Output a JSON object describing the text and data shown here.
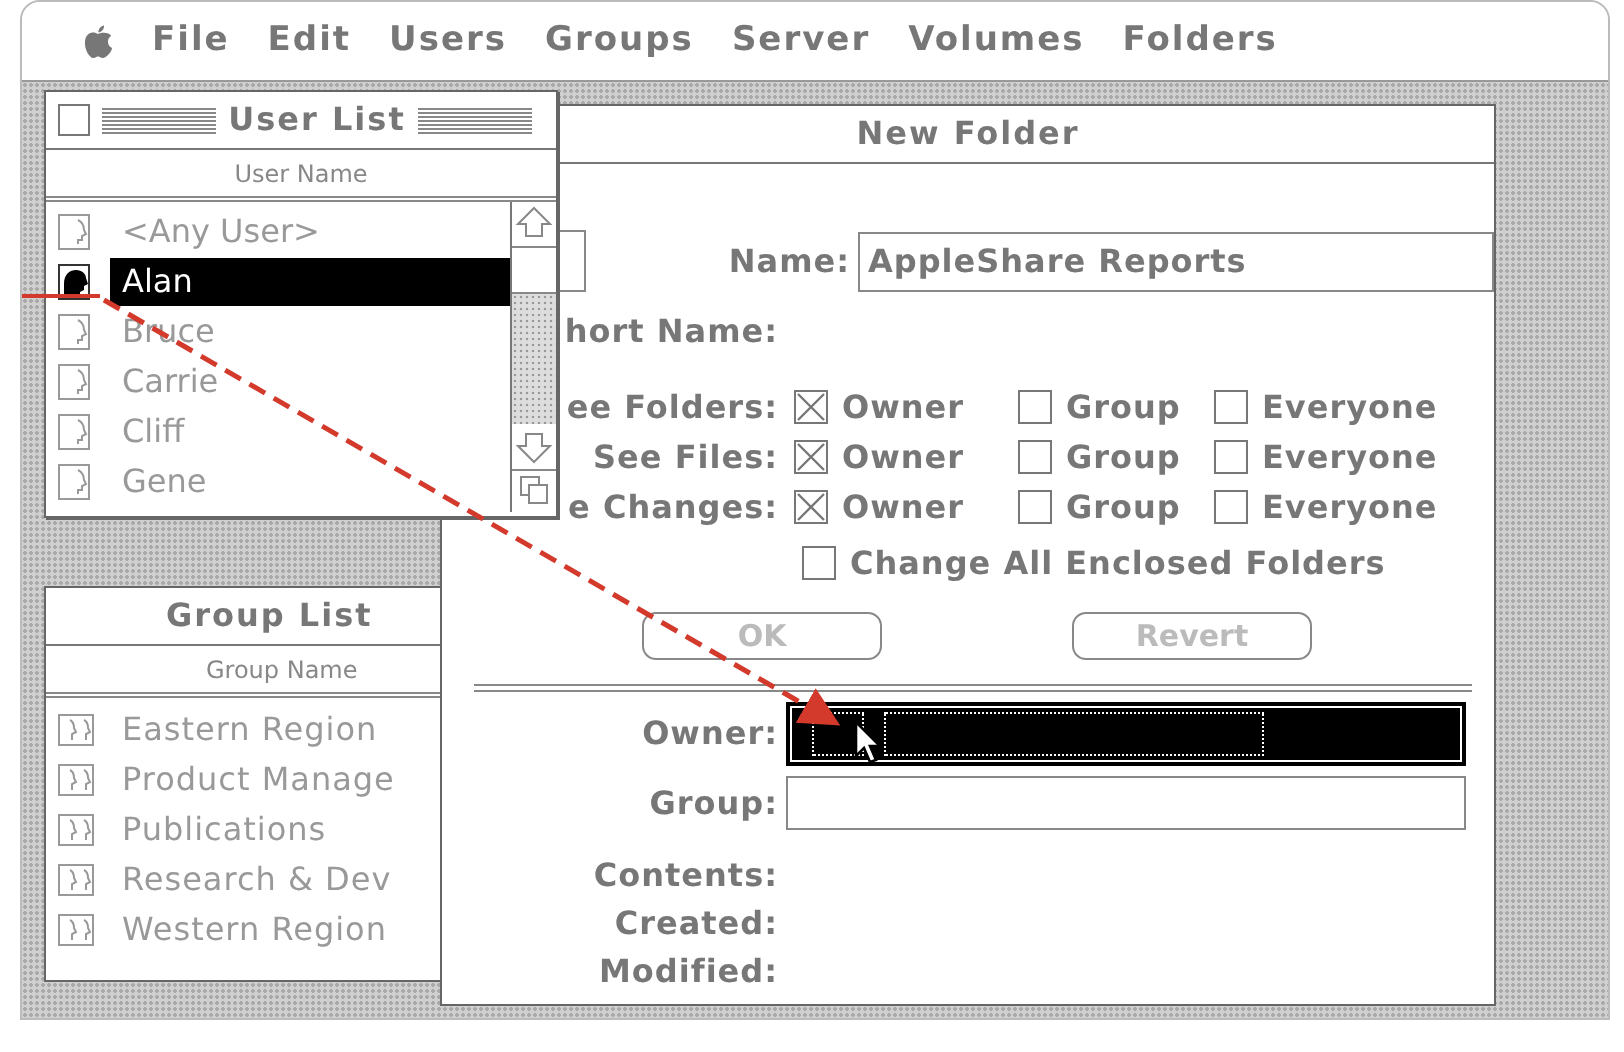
{
  "menu_bar": {
    "items": [
      "File",
      "Edit",
      "Users",
      "Groups",
      "Server",
      "Volumes",
      "Folders"
    ]
  },
  "new_folder": {
    "title": "New Folder",
    "name_field": {
      "label": "Name:",
      "value": "AppleShare Reports"
    },
    "short_name": {
      "label": "hort Name:"
    },
    "privileges": [
      {
        "label": "ee Folders:",
        "options": [
          {
            "label": "Owner",
            "checked": true
          },
          {
            "label": "Group",
            "checked": false
          },
          {
            "label": "Everyone",
            "checked": false
          }
        ]
      },
      {
        "label": "See Files:",
        "options": [
          {
            "label": "Owner",
            "checked": true
          },
          {
            "label": "Group",
            "checked": false
          },
          {
            "label": "Everyone",
            "checked": false
          }
        ]
      },
      {
        "label": "e Changes:",
        "options": [
          {
            "label": "Owner",
            "checked": true
          },
          {
            "label": "Group",
            "checked": false
          },
          {
            "label": "Everyone",
            "checked": false
          }
        ]
      }
    ],
    "change_all": {
      "label": "Change All Enclosed Folders",
      "checked": false
    },
    "buttons": [
      {
        "label": "OK",
        "disabled": true
      },
      {
        "label": "Revert",
        "disabled": true
      }
    ],
    "owner": {
      "label": "Owner:",
      "selected": true
    },
    "group": {
      "label": "Group:",
      "selected": false
    },
    "info": [
      "Contents:",
      "Created:",
      "Modified:"
    ]
  },
  "user_list": {
    "title": "User List",
    "column": "User Name",
    "items": [
      {
        "name": "<Any User>",
        "selected": false
      },
      {
        "name": "Alan",
        "selected": true
      },
      {
        "name": "Bruce",
        "selected": false
      },
      {
        "name": "Carrie",
        "selected": false
      },
      {
        "name": "Cliff",
        "selected": false
      },
      {
        "name": "Gene",
        "selected": false
      }
    ]
  },
  "group_list": {
    "title": "Group List",
    "column": "Group Name",
    "items": [
      "Eastern Region",
      "Product Manage",
      "Publications",
      "Research & Dev",
      "Western Region"
    ]
  }
}
